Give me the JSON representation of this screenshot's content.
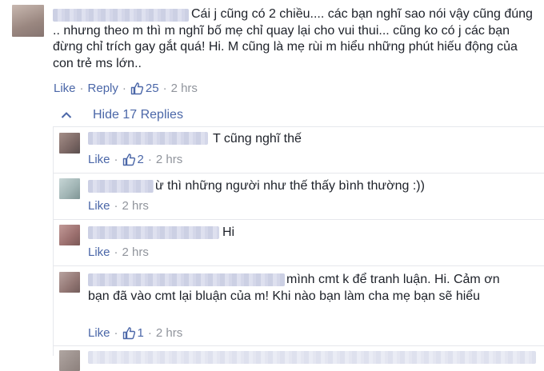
{
  "top_comment": {
    "text": "Cái j cũng có 2 chiều.... các bạn nghĩ sao nói vậy cũng đúng .. nhưng theo m thì m nghĩ bố mẹ chỉ quay lại cho vui thui... cũng ko có j các bạn đừng chỉ trích gay gắt quá! Hi. M cũng là mẹ rùi m hiểu những phút hiếu động của con trẻ ms lớn..",
    "like_label": "Like",
    "reply_label": "Reply",
    "likes": "25",
    "time": "2 hrs"
  },
  "replies_toggle": "Hide 17 Replies",
  "replies": [
    {
      "text": "T cũng nghĩ thế",
      "like_label": "Like",
      "likes": "2",
      "time": "2 hrs"
    },
    {
      "text": "ừ thì những người như thế thấy bình thường :))",
      "like_label": "Like",
      "time": "2 hrs"
    },
    {
      "text": "Hi",
      "like_label": "Like",
      "time": "2 hrs"
    },
    {
      "text": "mình cmt k để tranh luận. Hi. Cảm ơn bạn đã vào cmt lại bluận của m! Khi nào bạn làm cha mẹ bạn sẽ hiểu",
      "like_label": "Like",
      "likes": "1",
      "time": "2 hrs"
    }
  ]
}
